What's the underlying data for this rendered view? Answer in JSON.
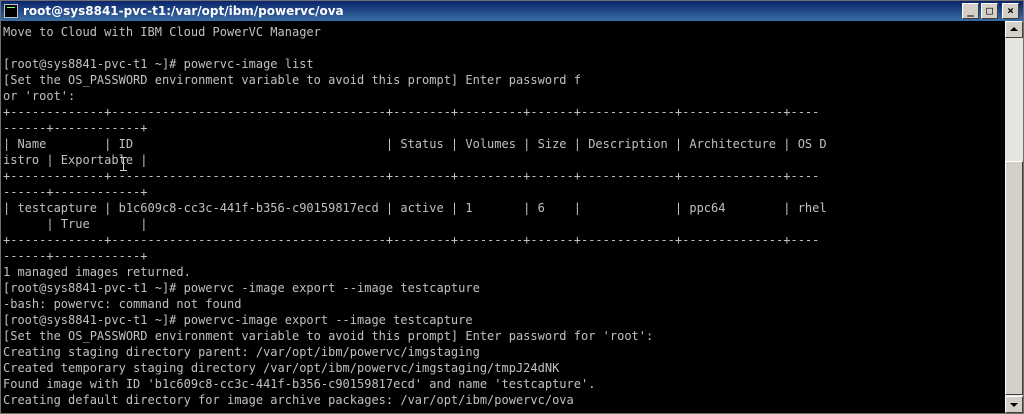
{
  "window": {
    "title": "root@sys8841-pvc-t1:/var/opt/ibm/powervc/ova",
    "minimize_glyph": "_",
    "maximize_glyph": "□",
    "close_glyph": "×"
  },
  "terminal": {
    "lines": [
      "Move to Cloud with IBM Cloud PowerVC Manager",
      "",
      "[root@sys8841-pvc-t1 ~]# powervc-image list",
      "[Set the OS_PASSWORD environment variable to avoid this prompt] Enter password f",
      "or 'root':",
      "+-------------+--------------------------------------+--------+---------+------+-------------+--------------+----",
      "------+------------+",
      "| Name        | ID                                   | Status | Volumes | Size | Description | Architecture | OS D",
      "istro | Exportable |",
      "+-------------+--------------------------------------+--------+---------+------+-------------+--------------+----",
      "------+------------+",
      "| testcapture | b1c609c8-cc3c-441f-b356-c90159817ecd | active | 1       | 6    |             | ppc64        | rhel",
      "      | True       |",
      "+-------------+--------------------------------------+--------+---------+------+-------------+--------------+----",
      "------+------------+",
      "1 managed images returned.",
      "[root@sys8841-pvc-t1 ~]# powervc -image export --image testcapture",
      "-bash: powervc: command not found",
      "[root@sys8841-pvc-t1 ~]# powervc-image export --image testcapture",
      "[Set the OS_PASSWORD environment variable to avoid this prompt] Enter password for 'root':",
      "Creating staging directory parent: /var/opt/ibm/powervc/imgstaging",
      "Created temporary staging directory /var/opt/ibm/powervc/imgstaging/tmpJ24dNK",
      "Found image with ID 'b1c609c8-cc3c-441f-b356-c90159817ecd' and name 'testcapture'.",
      "Creating default directory for image archive packages: /var/opt/ibm/powervc/ova"
    ]
  },
  "colors": {
    "terminal_bg": "#000000",
    "terminal_fg": "#c0c0c0",
    "titlebar": "#0a246a"
  }
}
